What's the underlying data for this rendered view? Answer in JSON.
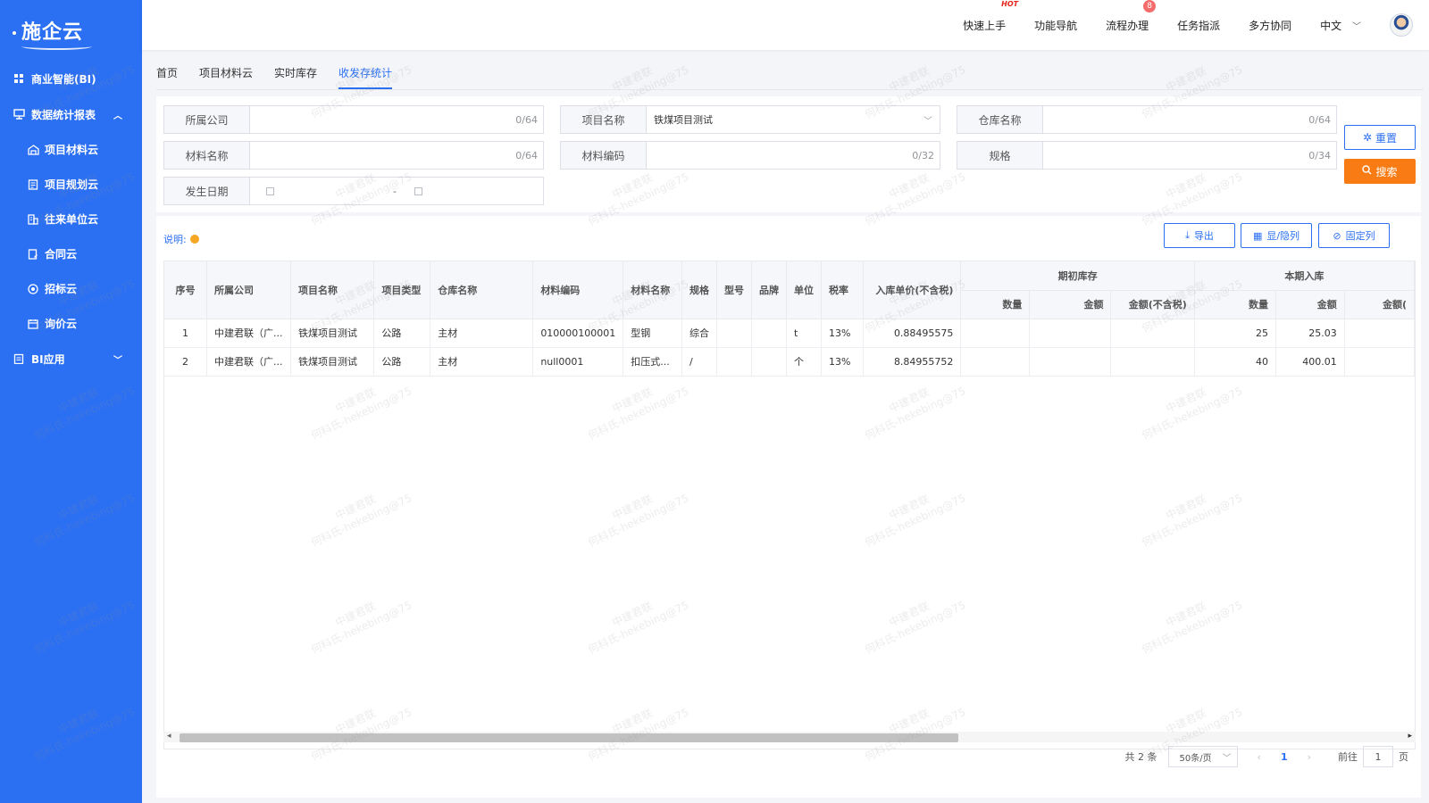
{
  "sidebar": {
    "logo": "施企云",
    "items": [
      {
        "label": "商业智能(BI)"
      },
      {
        "label": "数据统计报表"
      },
      {
        "label": "项目材料云"
      },
      {
        "label": "项目规划云"
      },
      {
        "label": "往来单位云"
      },
      {
        "label": "合同云"
      },
      {
        "label": "招标云"
      },
      {
        "label": "询价云"
      },
      {
        "label": "BI应用"
      }
    ]
  },
  "header": {
    "menu": [
      "快速上手",
      "功能导航",
      "流程办理",
      "任务指派",
      "多方协同",
      "中文"
    ],
    "hot": "HOT",
    "badge": "8"
  },
  "tabs": [
    "首页",
    "项目材料云",
    "实时库存",
    "收发存统计"
  ],
  "filter": {
    "company": {
      "label": "所属公司",
      "count": "0/64"
    },
    "project": {
      "label": "项目名称",
      "value": "铁煤项目测试"
    },
    "warehouse": {
      "label": "仓库名称",
      "count": "0/64"
    },
    "material": {
      "label": "材料名称",
      "count": "0/64"
    },
    "code": {
      "label": "材料编码",
      "count": "0/32"
    },
    "spec": {
      "label": "规格",
      "count": "0/34"
    },
    "date": {
      "label": "发生日期",
      "sep": "-"
    },
    "reset": "重置",
    "search": "搜索"
  },
  "toolbar": {
    "note": "说明:",
    "export": "导出",
    "toggle_cols": "显/隐列",
    "fix_cols": "固定列"
  },
  "table": {
    "headers": {
      "seq": "序号",
      "company": "所属公司",
      "project": "项目名称",
      "ptype": "项目类型",
      "warehouse": "仓库名称",
      "code": "材料编码",
      "mname": "材料名称",
      "spec": "规格",
      "model": "型号",
      "brand": "品牌",
      "unit": "单位",
      "tax": "税率",
      "price": "入库单价(不含税)",
      "group1": "期初库存",
      "group2": "本期入库",
      "qty": "数量",
      "amount": "金额",
      "amount_nt": "金额(不含税)",
      "amount_cut": "金额("
    },
    "rows": [
      [
        "1",
        "中建君联（广...",
        "铁煤项目测试",
        "公路",
        "主材",
        "010000100001",
        "型钢",
        "综合",
        "",
        "",
        "t",
        "13%",
        "0.88495575",
        "",
        "",
        "",
        "25",
        "25.03",
        ""
      ],
      [
        "2",
        "中建君联（广...",
        "铁煤项目测试",
        "公路",
        "主材",
        "null0001",
        "扣压式...",
        "/",
        "",
        "",
        "个",
        "13%",
        "8.84955752",
        "",
        "",
        "",
        "40",
        "400.01",
        ""
      ]
    ]
  },
  "pager": {
    "total": "共 2 条",
    "size": "50条/页",
    "page": "1",
    "goto": "前往",
    "goto_val": "1",
    "page_unit": "页"
  },
  "watermark": {
    "line1": "中建君联",
    "line2": "何科氏-hekebing@75"
  }
}
